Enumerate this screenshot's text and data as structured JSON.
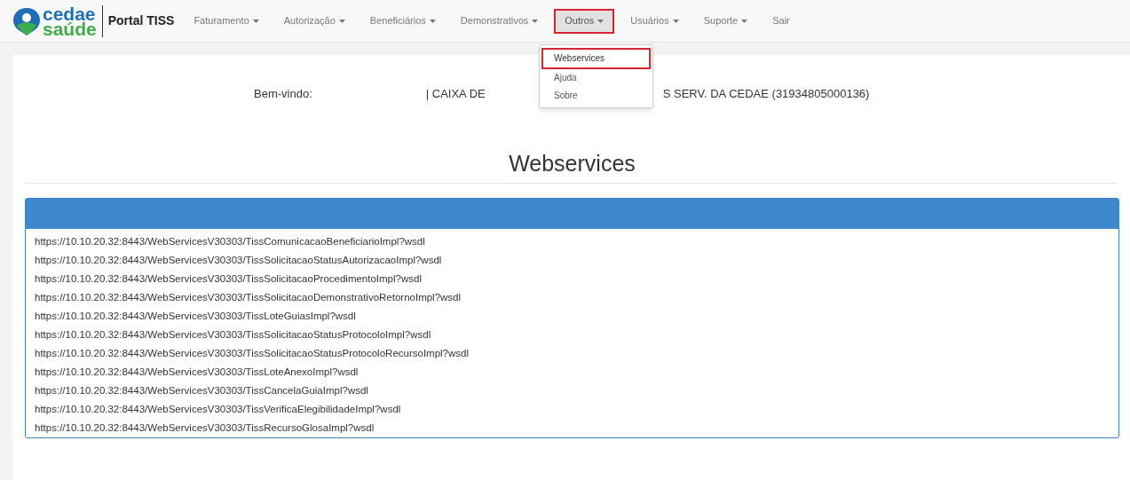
{
  "brand": {
    "logo_top": "cedae",
    "logo_bottom": "saúde",
    "title": "Portal TISS"
  },
  "nav": [
    {
      "label": "Faturamento",
      "dropdown": true,
      "selected": false
    },
    {
      "label": "Autorização",
      "dropdown": true,
      "selected": false
    },
    {
      "label": "Beneficiários",
      "dropdown": true,
      "selected": false
    },
    {
      "label": "Demonstrativos",
      "dropdown": true,
      "selected": false
    },
    {
      "label": "Outros",
      "dropdown": true,
      "selected": true
    },
    {
      "label": "Usuários",
      "dropdown": true,
      "selected": false
    },
    {
      "label": "Suporte",
      "dropdown": true,
      "selected": false
    },
    {
      "label": "Sair",
      "dropdown": false,
      "selected": false
    }
  ],
  "menu": [
    {
      "label": "Webservices",
      "selected": true
    },
    {
      "label": "Ajuda",
      "selected": false
    },
    {
      "label": "Sobre",
      "selected": false
    }
  ],
  "welcome": {
    "label": "Bem-vindo:",
    "org_start": "| CAIXA DE",
    "org_end": "S SERV. DA CEDAE (31934805000136)"
  },
  "page_title": "Webservices",
  "links": [
    "https://10.10.20.32:8443/WebServicesV30303/TissComunicacaoBeneficiarioImpl?wsdl",
    "https://10.10.20.32:8443/WebServicesV30303/TissSolicitacaoStatusAutorizacaoImpl?wsdl",
    "https://10.10.20.32:8443/WebServicesV30303/TissSolicitacaoProcedimentoImpl?wsdl",
    "https://10.10.20.32:8443/WebServicesV30303/TissSolicitacaoDemonstrativoRetornoImpl?wsdl",
    "https://10.10.20.32:8443/WebServicesV30303/TissLoteGuiasImpl?wsdl",
    "https://10.10.20.32:8443/WebServicesV30303/TissSolicitacaoStatusProtocoloImpl?wsdl",
    "https://10.10.20.32:8443/WebServicesV30303/TissSolicitacaoStatusProtocoloRecursoImpl?wsdl",
    "https://10.10.20.32:8443/WebServicesV30303/TissLoteAnexoImpl?wsdl",
    "https://10.10.20.32:8443/WebServicesV30303/TissCancelaGuiaImpl?wsdl",
    "https://10.10.20.32:8443/WebServicesV30303/TissVerificaElegibilidadeImpl?wsdl",
    "https://10.10.20.32:8443/WebServicesV30303/TissRecursoGlosaImpl?wsdl"
  ]
}
